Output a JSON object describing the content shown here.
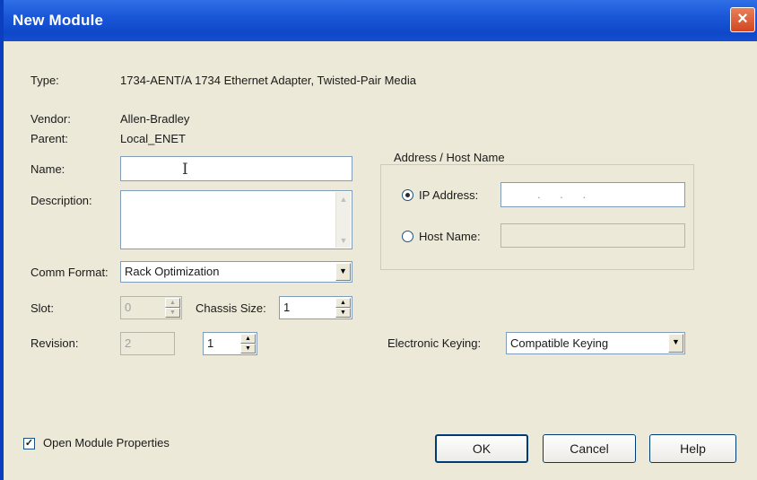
{
  "window": {
    "title": "New Module",
    "close_glyph": "×"
  },
  "fields": {
    "type": {
      "label": "Type:",
      "value": "1734-AENT/A 1734 Ethernet Adapter, Twisted-Pair Media"
    },
    "vendor": {
      "label": "Vendor:",
      "value": "Allen-Bradley"
    },
    "parent": {
      "label": "Parent:",
      "value": "Local_ENET"
    },
    "name": {
      "label": "Name:",
      "value": ""
    },
    "description": {
      "label": "Description:",
      "value": ""
    },
    "comm_format": {
      "label": "Comm Format:",
      "value": "Rack Optimization"
    },
    "slot": {
      "label": "Slot:",
      "value": "0"
    },
    "chassis_size": {
      "label": "Chassis Size:",
      "value": "1"
    },
    "revision": {
      "label": "Revision:",
      "major": "2",
      "minor": "1"
    },
    "electronic_keying": {
      "label": "Electronic Keying:",
      "value": "Compatible Keying"
    }
  },
  "address_group": {
    "title": "Address / Host Name",
    "ip_option": {
      "label": "IP Address:",
      "selected": true,
      "value": ".   .   ."
    },
    "host_option": {
      "label": "Host Name:",
      "selected": false,
      "value": ""
    }
  },
  "open_properties": {
    "label": "Open Module Properties",
    "checked": true
  },
  "buttons": {
    "ok": "OK",
    "cancel": "Cancel",
    "help": "Help"
  },
  "icons": [
    "close-icon",
    "dropdown-arrow-icon",
    "spinner-up-icon",
    "spinner-down-icon",
    "text-cursor-icon"
  ]
}
